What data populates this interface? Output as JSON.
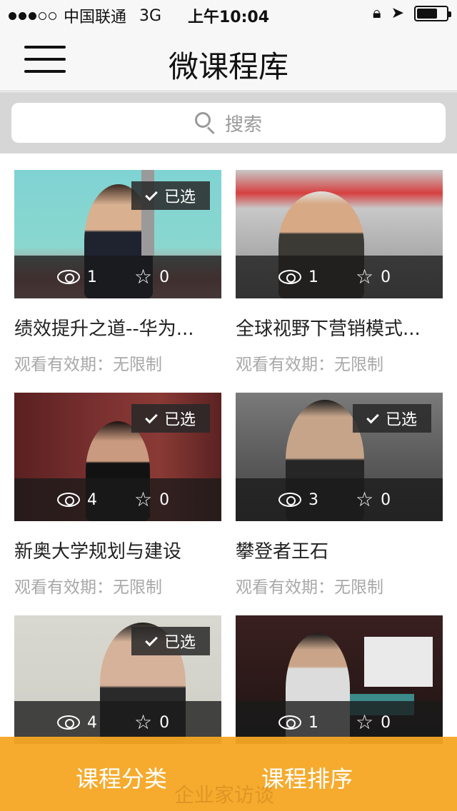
{
  "status_bar": {
    "carrier": "中国联通",
    "network": "3G",
    "time": "上午10:04"
  },
  "nav": {
    "title": "微课程库",
    "menu_icon": "hamburger-menu-icon"
  },
  "search": {
    "placeholder": "搜索",
    "icon": "search-icon"
  },
  "courses": [
    {
      "title": "绩效提升之道--华为...",
      "validity": "观看有效期：无限制",
      "views": "1",
      "favorites": "0",
      "selected_label": "已选",
      "selected": true
    },
    {
      "title": "全球视野下营销模式...",
      "validity": "观看有效期：无限制",
      "views": "1",
      "favorites": "0",
      "selected": false
    },
    {
      "title": "新奥大学规划与建设",
      "validity": "观看有效期：无限制",
      "views": "4",
      "favorites": "0",
      "selected_label": "已选",
      "selected": true
    },
    {
      "title": "攀登者王石",
      "validity": "观看有效期：无限制",
      "views": "3",
      "favorites": "0",
      "selected_label": "已选",
      "selected": true
    },
    {
      "title": "",
      "validity": "",
      "views": "4",
      "favorites": "0",
      "selected_label": "已选",
      "selected": true
    },
    {
      "title": "",
      "validity": "",
      "views": "1",
      "favorites": "0",
      "selected": false
    }
  ],
  "bottom_bar": {
    "category_label": "课程分类",
    "sort_label": "课程排序",
    "obscured_text": "企业家访谈",
    "color": "#f5a623"
  }
}
